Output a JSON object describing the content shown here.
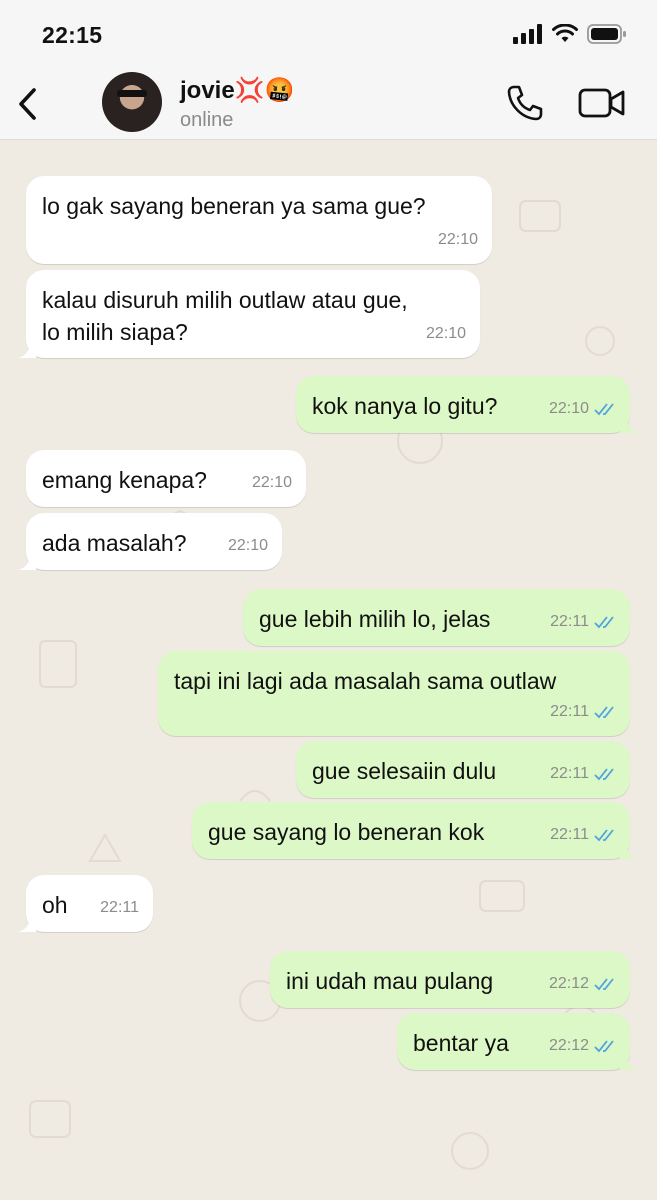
{
  "status_bar": {
    "time": "22:15"
  },
  "header": {
    "contact_name": "jovie💢🤬",
    "contact_status": "online"
  },
  "messages": [
    {
      "direction": "in",
      "text": "lo gak sayang beneran ya sama gue?",
      "time": "22:10"
    },
    {
      "direction": "in",
      "text": "kalau disuruh milih outlaw atau gue,\nlo milih siapa?",
      "time": "22:10"
    },
    {
      "direction": "out",
      "text": "kok nanya lo gitu?",
      "time": "22:10",
      "status": "read"
    },
    {
      "direction": "in",
      "text": "emang kenapa?",
      "time": "22:10"
    },
    {
      "direction": "in",
      "text": "ada masalah?",
      "time": "22:10"
    },
    {
      "direction": "out",
      "text": "gue lebih milih lo, jelas",
      "time": "22:11",
      "status": "read"
    },
    {
      "direction": "out",
      "text": "tapi ini lagi ada masalah sama outlaw",
      "time": "22:11",
      "status": "read"
    },
    {
      "direction": "out",
      "text": "gue selesaiin dulu",
      "time": "22:11",
      "status": "read"
    },
    {
      "direction": "out",
      "text": "gue sayang lo beneran kok",
      "time": "22:11",
      "status": "read"
    },
    {
      "direction": "in",
      "text": "oh",
      "time": "22:11"
    },
    {
      "direction": "out",
      "text": "ini udah mau pulang",
      "time": "22:12",
      "status": "read"
    },
    {
      "direction": "out",
      "text": "bentar ya",
      "time": "22:12",
      "status": "read"
    }
  ],
  "colors": {
    "incoming_bubble": "#ffffff",
    "outgoing_bubble": "#dcf8c6",
    "read_ticks": "#4fa3e0",
    "chat_background": "#efeae2"
  },
  "icons": [
    "signal-icon",
    "wifi-icon",
    "battery-icon",
    "back-chevron-icon",
    "phone-icon",
    "video-camera-icon",
    "double-check-icon"
  ]
}
